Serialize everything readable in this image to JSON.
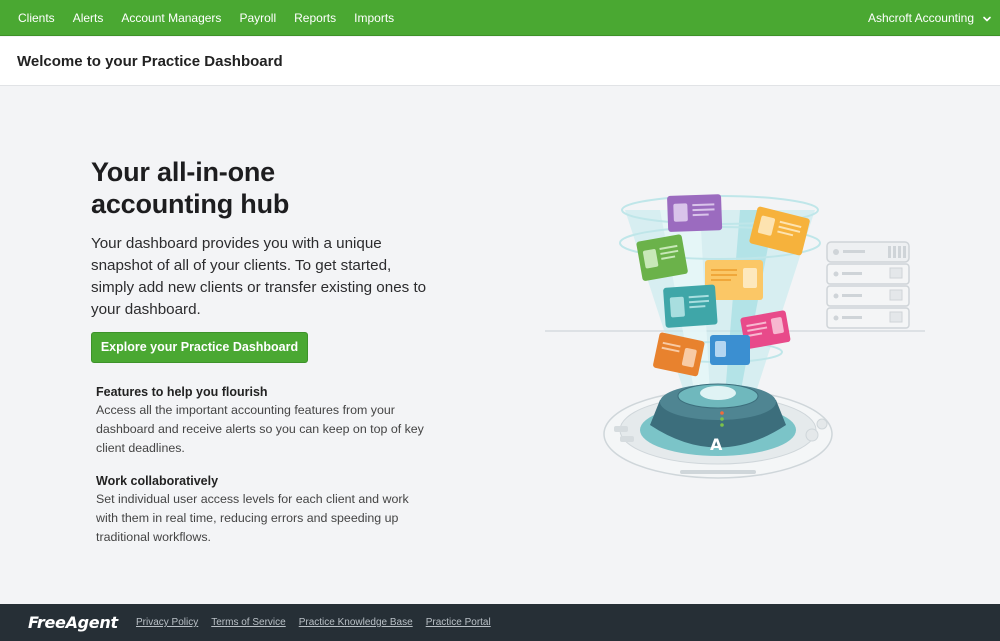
{
  "nav": {
    "items": [
      {
        "label": "Clients"
      },
      {
        "label": "Alerts"
      },
      {
        "label": "Account Managers"
      },
      {
        "label": "Payroll"
      },
      {
        "label": "Reports"
      },
      {
        "label": "Imports"
      }
    ],
    "account_label": "Ashcroft Accounting",
    "account_icon": "chevron-down-icon"
  },
  "page": {
    "title": "Welcome to your Practice Dashboard"
  },
  "hero": {
    "heading_line1": "Your all-in-one",
    "heading_line2": "accounting hub",
    "lead": "Your dashboard provides you with a unique snapshot of all of your clients. To get started, simply add new clients or transfer existing ones to your dashboard.",
    "cta_label": "Explore your Practice Dashboard"
  },
  "features": [
    {
      "title": "Features to help you flourish",
      "body": "Access all the important accounting features from your dashboard and receive alerts so you can keep on top of key client deadlines."
    },
    {
      "title": "Work collaboratively",
      "body": "Set individual user access levels for each client and work with them in real time, reducing errors and speeding up traditional workflows."
    }
  ],
  "illustration": {
    "subject": "client-folders-funnel-illustration",
    "folder_colors": [
      "#9b6bbf",
      "#f6b23c",
      "#6bb24a",
      "#fbc766",
      "#3fa6a8",
      "#e84a8a",
      "#e8822e",
      "#3b8fd1"
    ]
  },
  "footer": {
    "logo_text": "FreeAgent",
    "links": [
      {
        "label": "Privacy Policy"
      },
      {
        "label": "Terms of Service"
      },
      {
        "label": "Practice Knowledge Base"
      },
      {
        "label": "Practice Portal"
      }
    ]
  },
  "colors": {
    "brand_green": "#4aa832",
    "footer_bg": "#262f36",
    "page_bg": "#f3f4f6"
  }
}
